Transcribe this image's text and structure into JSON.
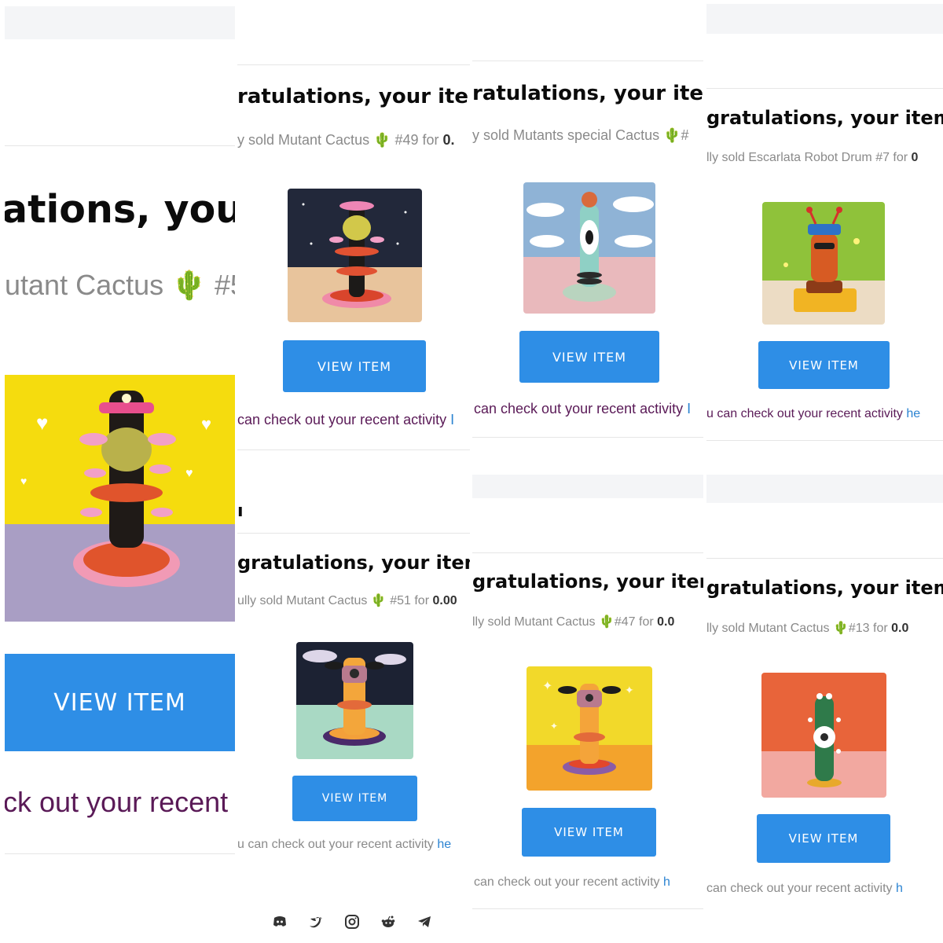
{
  "colors": {
    "accent": "#2e8ee6",
    "link": "#2b83d1",
    "activity_text": "#5a1a57",
    "subtitle_text": "#8a8a8a"
  },
  "panels": [
    {
      "title": "ations, your",
      "subtitle": "utant Cactus 🌵 #5",
      "button": "VIEW ITEM",
      "activity_prefix": "ck out your recent ",
      "activity_link": ""
    },
    {
      "title": "ratulations, your item",
      "subtitle_prefix": "y sold Mutant Cactus 🌵 #49 for ",
      "subtitle_bold": "0.",
      "button": "VIEW ITEM",
      "activity_prefix": "can check out your recent activity ",
      "activity_link": "I"
    },
    {
      "title": "ratulations, your item",
      "subtitle": "y sold Mutants special Cactus 🌵#",
      "button": "VIEW ITEM",
      "activity_prefix": "can check out your recent activity ",
      "activity_link": "I"
    },
    {
      "title": "gratulations, your item s",
      "subtitle_prefix": "lly sold Escarlata Robot Drum #7 for ",
      "subtitle_bold": "0",
      "button": "VIEW ITEM",
      "activity_prefix": "u can check out your recent activity ",
      "activity_link": "he"
    },
    {
      "title": "gratulations, your item s",
      "subtitle_prefix": "ully sold Mutant Cactus 🌵 #51 for ",
      "subtitle_bold": "0.00",
      "button": "VIEW ITEM",
      "activity_prefix": "u can check out your recent activity ",
      "activity_link": "he"
    },
    {
      "title": "gratulations, your item",
      "subtitle_prefix": "lly sold Mutant Cactus 🌵#47 for ",
      "subtitle_bold": "0.0",
      "button": "VIEW ITEM",
      "activity_prefix": "can check out your recent activity ",
      "activity_link": "h"
    },
    {
      "title": "gratulations, your item",
      "subtitle_prefix": "lly sold Mutant Cactus 🌵#13 for ",
      "subtitle_bold": "0.0",
      "button": "VIEW ITEM",
      "activity_prefix": "can check out your recent activity ",
      "activity_link": "h"
    }
  ],
  "footer_icons": [
    "discord-icon",
    "twitter-icon",
    "instagram-icon",
    "reddit-icon",
    "telegram-icon"
  ]
}
